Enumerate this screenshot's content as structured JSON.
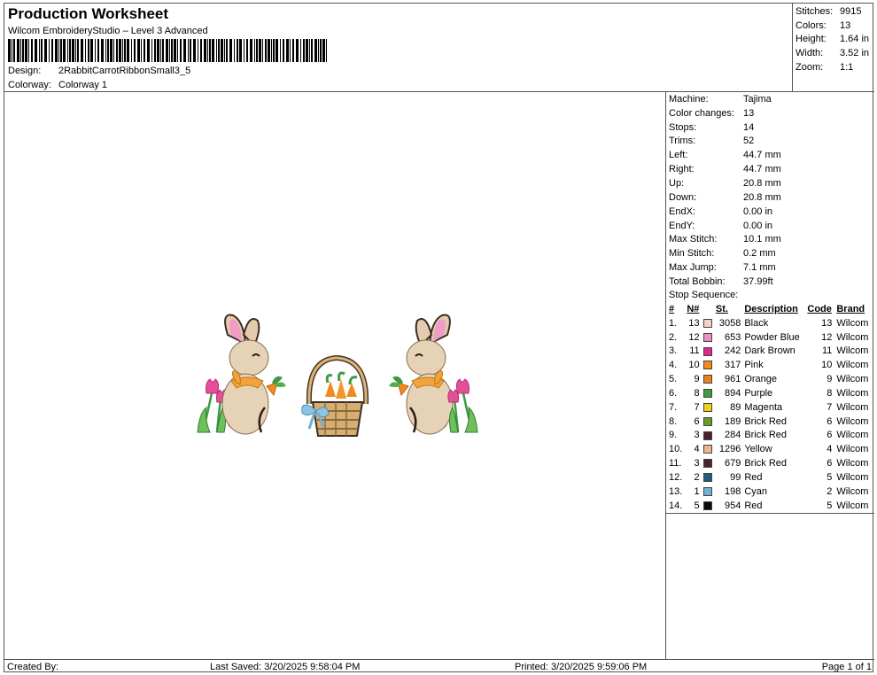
{
  "header": {
    "title": "Production Worksheet",
    "subtitle": "Wilcom EmbroideryStudio – Level 3 Advanced",
    "design_label": "Design:",
    "design_value": "2RabbitCarrotRibbonSmall3_5",
    "colorway_label": "Colorway:",
    "colorway_value": "Colorway 1"
  },
  "stats": [
    {
      "label": "Stitches:",
      "value": "9915"
    },
    {
      "label": "Colors:",
      "value": "13"
    },
    {
      "label": "Height:",
      "value": "1.64 in"
    },
    {
      "label": "Width:",
      "value": "3.52 in"
    },
    {
      "label": "Zoom:",
      "value": "1:1"
    }
  ],
  "machine_info": [
    {
      "label": "Machine:",
      "value": "Tajima"
    },
    {
      "label": "Color changes:",
      "value": "13"
    },
    {
      "label": "Stops:",
      "value": "14"
    },
    {
      "label": "Trims:",
      "value": "52"
    },
    {
      "label": "Left:",
      "value": "44.7 mm"
    },
    {
      "label": "Right:",
      "value": "44.7 mm"
    },
    {
      "label": "Up:",
      "value": "20.8 mm"
    },
    {
      "label": "Down:",
      "value": "20.8 mm"
    },
    {
      "label": "EndX:",
      "value": "0.00 in"
    },
    {
      "label": "EndY:",
      "value": "0.00 in"
    },
    {
      "label": "Max Stitch:",
      "value": "10.1 mm"
    },
    {
      "label": "Min Stitch:",
      "value": "0.2 mm"
    },
    {
      "label": "Max Jump:",
      "value": "7.1 mm"
    },
    {
      "label": "Total Bobbin:",
      "value": "37.99ft"
    }
  ],
  "stop_sequence": {
    "title": "Stop Sequence:",
    "headers": {
      "idx": "#",
      "n": "N#",
      "st": "St.",
      "desc": "Description",
      "code": "Code",
      "brand": "Brand"
    },
    "rows": [
      {
        "idx": "1.",
        "n": "13",
        "color": "#f3d3c8",
        "st": "3058",
        "desc": "Black",
        "code": "13",
        "brand": "Wilcom"
      },
      {
        "idx": "2.",
        "n": "12",
        "color": "#ee8fc4",
        "st": "653",
        "desc": "Powder Blue",
        "code": "12",
        "brand": "Wilcom"
      },
      {
        "idx": "3.",
        "n": "11",
        "color": "#e0288e",
        "st": "242",
        "desc": "Dark Brown",
        "code": "11",
        "brand": "Wilcom"
      },
      {
        "idx": "4.",
        "n": "10",
        "color": "#f28a1c",
        "st": "317",
        "desc": "Pink",
        "code": "10",
        "brand": "Wilcom"
      },
      {
        "idx": "5.",
        "n": "9",
        "color": "#e8841f",
        "st": "961",
        "desc": "Orange",
        "code": "9",
        "brand": "Wilcom"
      },
      {
        "idx": "6.",
        "n": "8",
        "color": "#3f9a45",
        "st": "894",
        "desc": "Purple",
        "code": "8",
        "brand": "Wilcom"
      },
      {
        "idx": "7.",
        "n": "7",
        "color": "#f2cf1a",
        "st": "89",
        "desc": "Magenta",
        "code": "7",
        "brand": "Wilcom"
      },
      {
        "idx": "8.",
        "n": "6",
        "color": "#6a9c2b",
        "st": "189",
        "desc": "Brick Red",
        "code": "6",
        "brand": "Wilcom"
      },
      {
        "idx": "9.",
        "n": "3",
        "color": "#4a2228",
        "st": "284",
        "desc": "Brick Red",
        "code": "6",
        "brand": "Wilcom"
      },
      {
        "idx": "10.",
        "n": "4",
        "color": "#e8b88e",
        "st": "1296",
        "desc": "Yellow",
        "code": "4",
        "brand": "Wilcom"
      },
      {
        "idx": "11.",
        "n": "3",
        "color": "#4a2228",
        "st": "679",
        "desc": "Brick Red",
        "code": "6",
        "brand": "Wilcom"
      },
      {
        "idx": "12.",
        "n": "2",
        "color": "#245b7e",
        "st": "99",
        "desc": "Red",
        "code": "5",
        "brand": "Wilcom"
      },
      {
        "idx": "13.",
        "n": "1",
        "color": "#6fb2d6",
        "st": "198",
        "desc": "Cyan",
        "code": "2",
        "brand": "Wilcom"
      },
      {
        "idx": "14.",
        "n": "5",
        "color": "#0a0a0a",
        "st": "954",
        "desc": "Red",
        "code": "5",
        "brand": "Wilcom"
      }
    ]
  },
  "footer": {
    "created_by": "Created By:",
    "last_saved": "Last Saved: 3/20/2025 9:58:04 PM",
    "printed": "Printed: 3/20/2025 9:59:06 PM",
    "page": "Page 1 of 1"
  }
}
